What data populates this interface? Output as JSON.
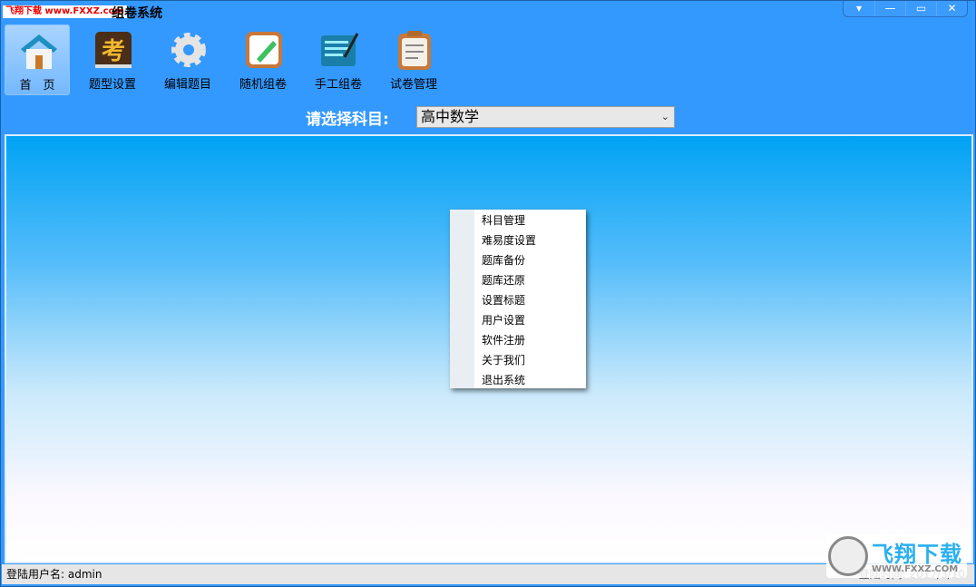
{
  "window": {
    "title": "组卷系统",
    "watermark": "飞翔下载 www.FXXZ.com",
    "controls": [
      "▾",
      "—",
      "▭",
      "✕"
    ]
  },
  "toolbar": [
    {
      "label": "首　页",
      "icon": "home-icon",
      "active": true
    },
    {
      "label": "题型设置",
      "icon": "exam-book-icon"
    },
    {
      "label": "编辑题目",
      "icon": "gear-icon"
    },
    {
      "label": "随机组卷",
      "icon": "pencil-paper-icon"
    },
    {
      "label": "手工组卷",
      "icon": "notepad-pen-icon"
    },
    {
      "label": "试卷管理",
      "icon": "clipboard-icon"
    }
  ],
  "subject": {
    "label": "请选择科目:",
    "value": "高中数学"
  },
  "context_menu": [
    "科目管理",
    "难易度设置",
    "题库备份",
    "题库还原",
    "设置标题",
    "用户设置",
    "软件注册",
    "关于我们",
    "退出系统"
  ],
  "status": {
    "user": "登陆用户名:  admin",
    "login_time": "登陆时间: 2017/3/10"
  },
  "logo": {
    "name": "飞翔下载",
    "url": "WWW.FXXZ.COM"
  }
}
